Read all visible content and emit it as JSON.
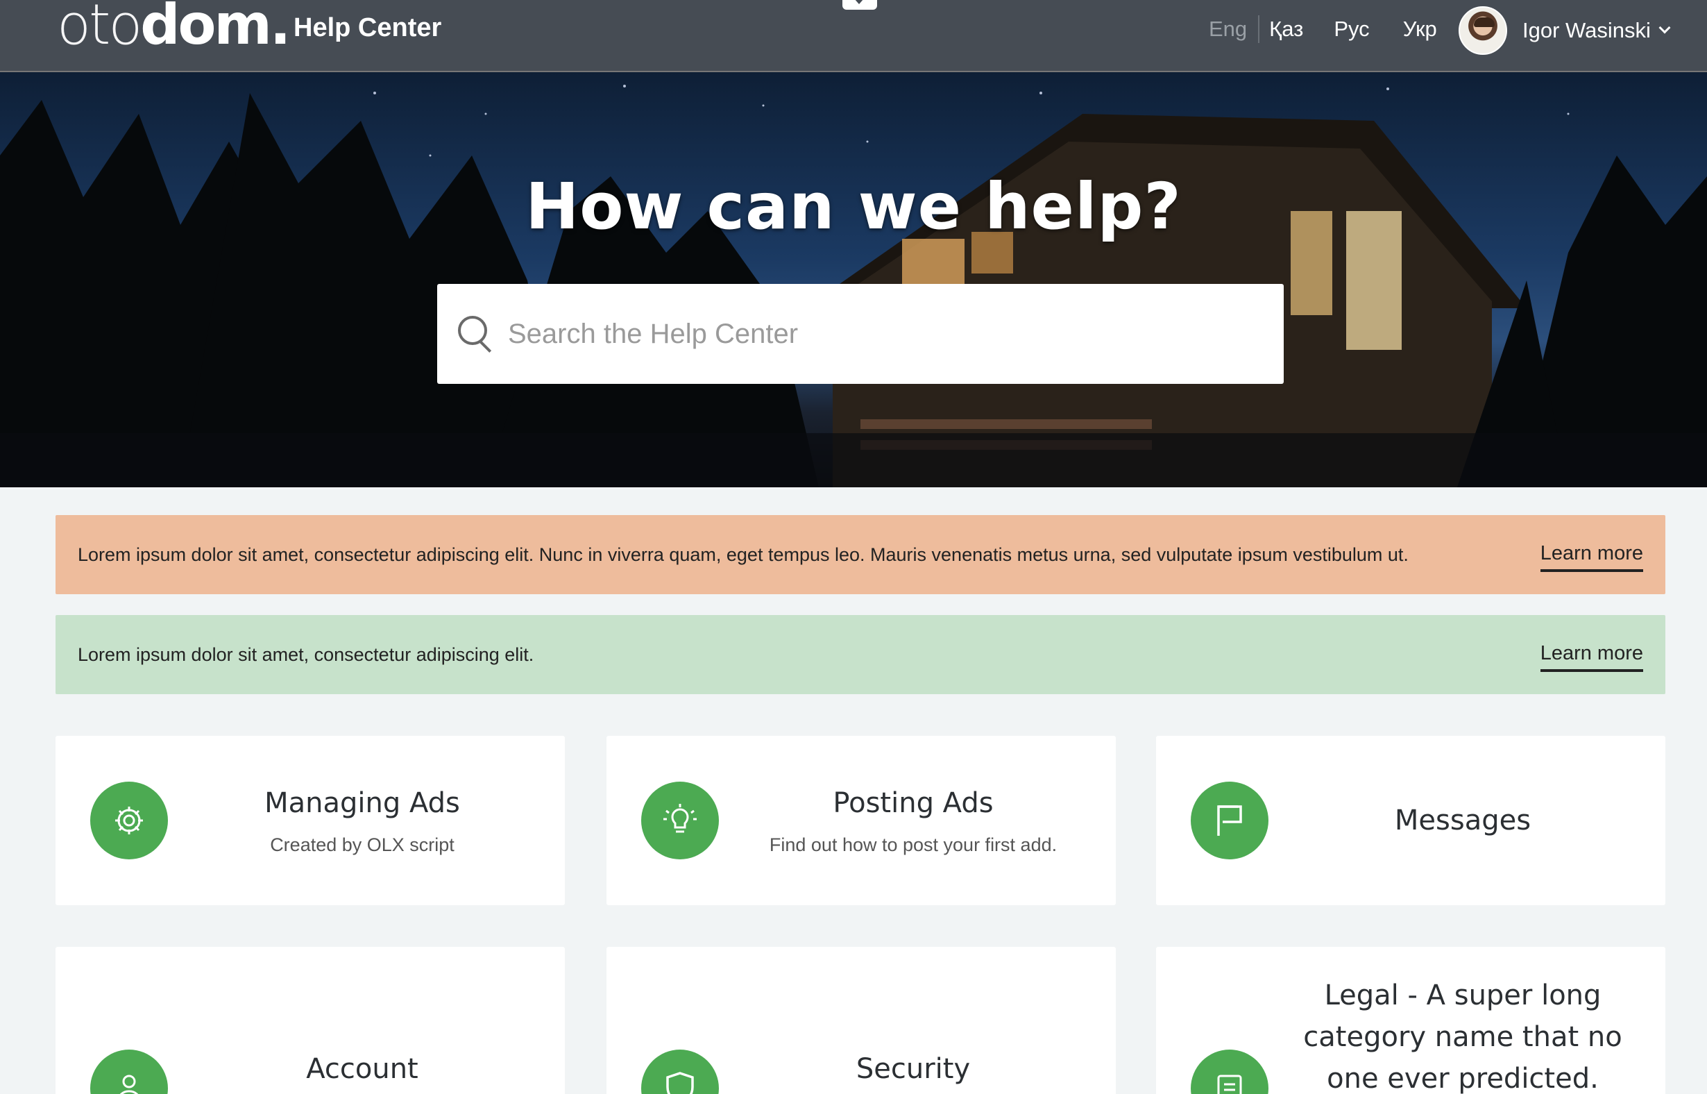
{
  "header": {
    "logo_thin": "oto",
    "logo_bold": "dom.",
    "title": "Help Center",
    "languages": [
      {
        "label": "Eng",
        "active": true
      },
      {
        "label": "Қаз"
      },
      {
        "label": "Рус"
      },
      {
        "label": "Укр"
      }
    ],
    "user_name": "Igor Wasinski"
  },
  "hero": {
    "title": "How can we help?",
    "search_placeholder": "Search the Help Center"
  },
  "notices": [
    {
      "text": "Lorem ipsum dolor sit amet, consectetur adipiscing elit. Nunc in viverra quam, eget tempus leo. Mauris venenatis metus urna, sed vulputate ipsum vestibulum ut.",
      "link": "Learn more",
      "color": "#eebc9c"
    },
    {
      "text": "Lorem ipsum dolor sit amet, consectetur adipiscing elit.",
      "link": "Learn more",
      "color": "#c7e2cb"
    }
  ],
  "categories": [
    {
      "title": "Managing Ads",
      "desc": "Created by OLX script",
      "icon": "gear-icon"
    },
    {
      "title": "Posting Ads",
      "desc": "Find out how to post your first add.",
      "icon": "lightbulb-icon"
    },
    {
      "title": "Messages",
      "desc": "",
      "icon": "flag-icon"
    },
    {
      "title": "Account",
      "desc": "",
      "icon": "user-icon"
    },
    {
      "title": "Security",
      "desc": "",
      "icon": "shield-icon"
    },
    {
      "title": "Legal - A super long category name that no one ever predicted.",
      "desc": "",
      "icon": "document-icon"
    }
  ],
  "colors": {
    "accent": "#4caa52",
    "topbar": "#464c54",
    "page_bg": "#f1f4f5"
  }
}
